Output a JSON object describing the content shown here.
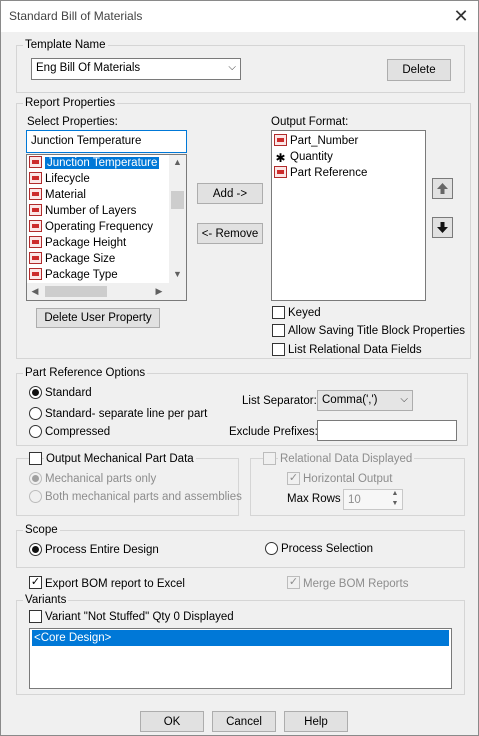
{
  "dialog": {
    "title": "Standard Bill of Materials"
  },
  "template": {
    "label": "Template Name",
    "value": "Eng Bill Of Materials",
    "delete_label": "Delete"
  },
  "report": {
    "label": "Report Properties",
    "select_label": "Select Properties:",
    "search_value": "Junction Temperature",
    "properties": [
      "Junction Temperature",
      "Lifecycle",
      "Material",
      "Number of Layers",
      "Operating Frequency",
      "Package Height",
      "Package Size",
      "Package Type"
    ],
    "add_label": "Add ->",
    "remove_label": "<- Remove",
    "delete_user_label": "Delete User Property",
    "output_label": "Output Format:",
    "output_items": [
      "Part_Number",
      "Quantity",
      "Part Reference"
    ],
    "keyed_label": "Keyed",
    "allow_label": "Allow Saving Title Block Properties",
    "list_rel_label": "List Relational Data Fields"
  },
  "partref": {
    "label": "Part Reference Options",
    "standard": "Standard",
    "standard_sep": "Standard- separate line per part",
    "compressed": "Compressed",
    "list_sep_label": "List Separator:",
    "list_sep_value": "Comma(',')",
    "exclude_label": "Exclude Prefixes:",
    "exclude_value": ""
  },
  "mech": {
    "label": "Output Mechanical Part Data",
    "only": "Mechanical parts only",
    "both": "Both mechanical parts and assemblies"
  },
  "relational": {
    "label": "Relational Data Displayed",
    "horizontal": "Horizontal Output",
    "max_rows_label": "Max Rows",
    "max_rows_value": "10"
  },
  "scope": {
    "label": "Scope",
    "entire": "Process Entire Design",
    "selection": "Process Selection"
  },
  "export_label": "Export BOM report to Excel",
  "merge_label": "Merge BOM Reports",
  "variants": {
    "label": "Variants",
    "not_stuffed": "Variant \"Not Stuffed\" Qty 0 Displayed",
    "items": [
      "<Core Design>"
    ]
  },
  "footer": {
    "ok": "OK",
    "cancel": "Cancel",
    "help": "Help"
  },
  "colors": {
    "accent": "#0078d7",
    "selection": "#0078d7",
    "part_icon": "#cc2b2b"
  },
  "icons": [
    "close-icon",
    "part-icon",
    "quantity-icon",
    "move-up-icon",
    "move-down-icon",
    "chevron-down-icon"
  ]
}
